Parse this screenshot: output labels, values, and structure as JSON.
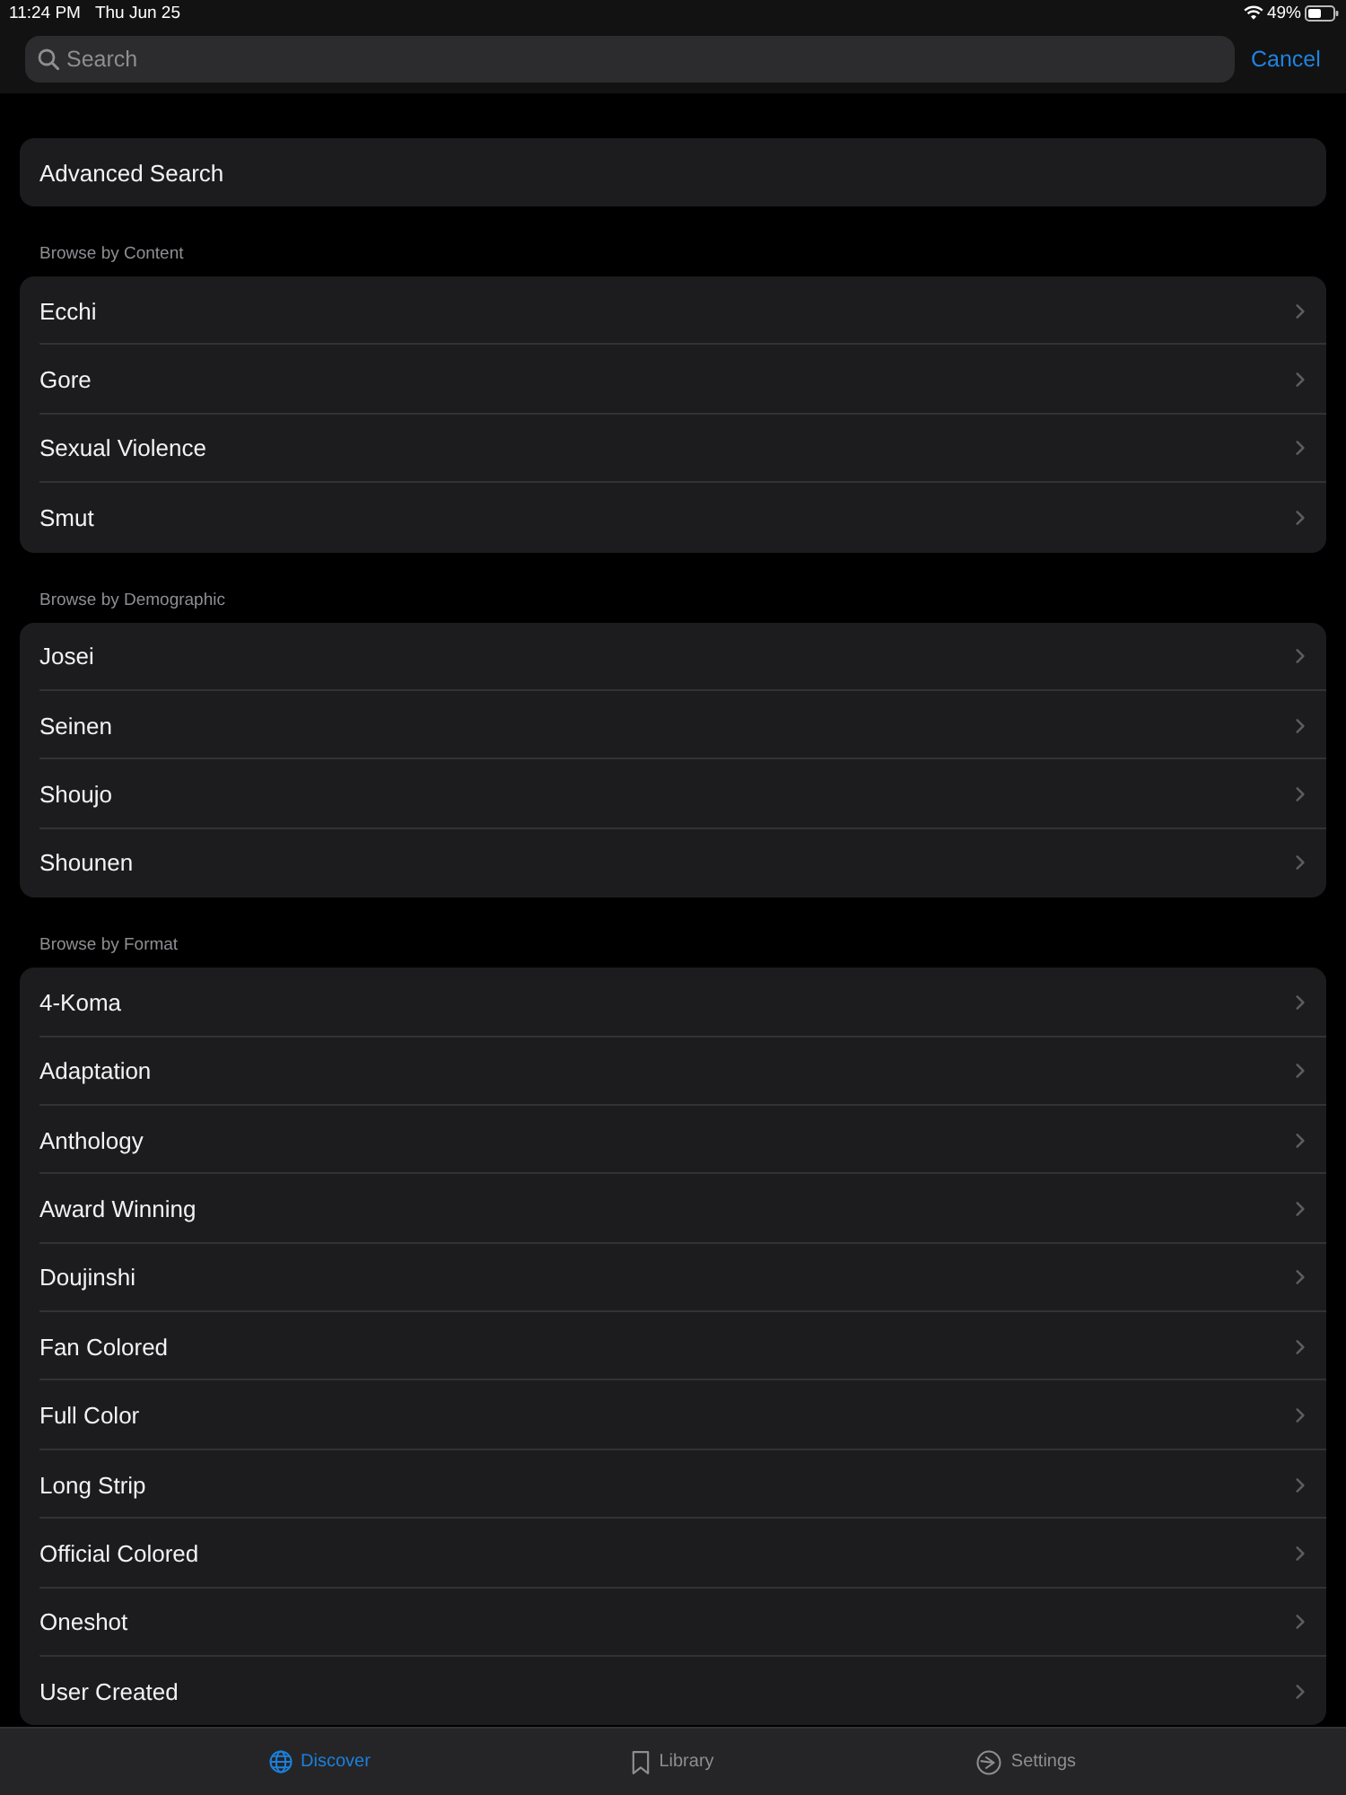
{
  "status_bar": {
    "time": "11:24 PM",
    "date": "Thu Jun 25",
    "battery": "49%"
  },
  "search": {
    "placeholder": "Search",
    "cancel": "Cancel"
  },
  "advanced_search": {
    "label": "Advanced Search"
  },
  "sections": [
    {
      "title": "Browse by Content",
      "items": [
        {
          "label": "Ecchi"
        },
        {
          "label": "Gore"
        },
        {
          "label": "Sexual Violence"
        },
        {
          "label": "Smut"
        }
      ]
    },
    {
      "title": "Browse by Demographic",
      "items": [
        {
          "label": "Josei"
        },
        {
          "label": "Seinen"
        },
        {
          "label": "Shoujo"
        },
        {
          "label": "Shounen"
        }
      ]
    },
    {
      "title": "Browse by Format",
      "items": [
        {
          "label": "4-Koma"
        },
        {
          "label": "Adaptation"
        },
        {
          "label": "Anthology"
        },
        {
          "label": "Award Winning"
        },
        {
          "label": "Doujinshi"
        },
        {
          "label": "Fan Colored"
        },
        {
          "label": "Full Color"
        },
        {
          "label": "Long Strip"
        },
        {
          "label": "Official Colored"
        },
        {
          "label": "Oneshot"
        },
        {
          "label": "User Created"
        }
      ]
    }
  ],
  "tab_bar": [
    {
      "label": "Discover",
      "selected": true
    },
    {
      "label": "Library",
      "selected": false
    },
    {
      "label": "Settings",
      "selected": false
    }
  ]
}
